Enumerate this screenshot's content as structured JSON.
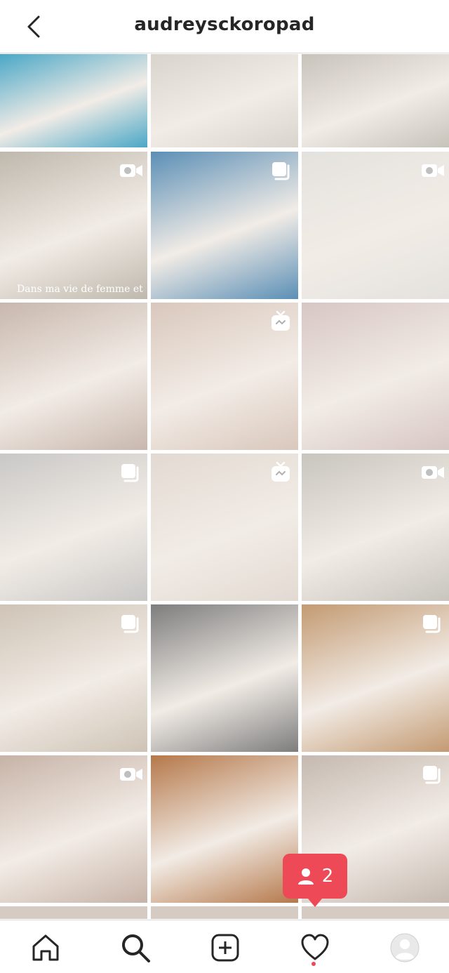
{
  "header": {
    "title": "audreysckoropad",
    "back_icon": "chevron-left-icon"
  },
  "grid": {
    "rows": [
      [
        {
          "name": "post-kids-painting",
          "badge": "none",
          "bg": "#4aa7c7"
        },
        {
          "name": "post-kitchen-mom",
          "badge": "none",
          "bg": "#d8d4cc"
        },
        {
          "name": "post-mom-holding-child",
          "badge": "none",
          "bg": "#c7c2ba"
        }
      ],
      [
        {
          "name": "post-woman-spoon",
          "badge": "video",
          "bg": "#bfb8ad",
          "overlay": "Dans ma vie de femme et"
        },
        {
          "name": "post-baby-pink-hat",
          "badge": "carousel",
          "bg": "#5b8fb6"
        },
        {
          "name": "post-woman-workout",
          "badge": "video",
          "bg": "#e4e2de"
        }
      ],
      [
        {
          "name": "post-girl-long-hair",
          "badge": "none",
          "bg": "#c8b7ad"
        },
        {
          "name": "post-girls-banana",
          "badge": "igtv",
          "bg": "#d9c7bc"
        },
        {
          "name": "post-mom-hug-kids",
          "badge": "none",
          "bg": "#d7c6c4"
        }
      ],
      [
        {
          "name": "post-boy-denim",
          "badge": "carousel",
          "bg": "#c9c8c6"
        },
        {
          "name": "post-baby-blue-eyes",
          "badge": "igtv",
          "bg": "#e2dad2"
        },
        {
          "name": "post-woman-bottle",
          "badge": "video",
          "bg": "#c8c4be"
        }
      ],
      [
        {
          "name": "post-baby-highchair",
          "badge": "carousel",
          "bg": "#cec3b5"
        },
        {
          "name": "post-woman-chair-bw",
          "badge": "none",
          "bg": "#7d7d7d"
        },
        {
          "name": "post-girl-puzzle",
          "badge": "carousel",
          "bg": "#c39a72"
        }
      ],
      [
        {
          "name": "post-mom-baby-smoothie",
          "badge": "video",
          "bg": "#c7b3a7"
        },
        {
          "name": "post-golden-puppy",
          "badge": "none",
          "bg": "#b5784a"
        },
        {
          "name": "post-mom-baby-bath",
          "badge": "carousel",
          "bg": "#c5b9b0"
        }
      ]
    ]
  },
  "notification": {
    "count": "2",
    "icon": "person-icon"
  },
  "nav": {
    "items": [
      {
        "name": "home",
        "icon": "home-icon"
      },
      {
        "name": "search",
        "icon": "search-icon"
      },
      {
        "name": "new-post",
        "icon": "plus-square-icon"
      },
      {
        "name": "activity",
        "icon": "heart-icon"
      },
      {
        "name": "profile",
        "icon": "avatar-icon"
      }
    ]
  }
}
